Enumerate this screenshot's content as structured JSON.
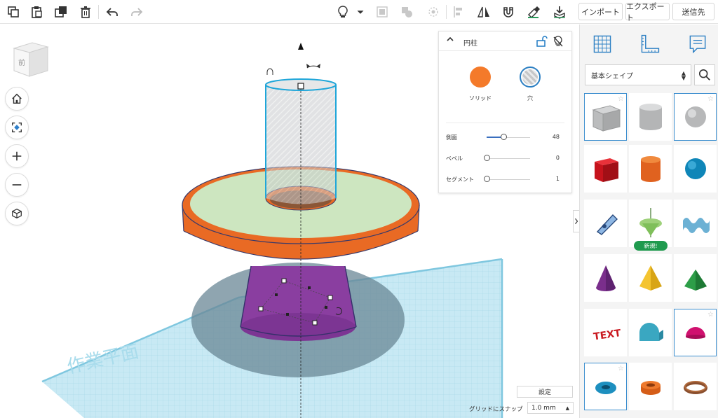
{
  "toolbar": {
    "left_icons": [
      "copy-icon",
      "paste-icon",
      "duplicate-icon",
      "trash-icon",
      "undo-icon",
      "redo-icon"
    ],
    "mid_icons": [
      "lightbulb-icon",
      "dropdown-caret-icon",
      "group-icon",
      "ungroup-icon",
      "workplane-icon",
      "align-icon",
      "mirror-icon",
      "magnet-icon",
      "cruise-icon",
      "drop-icon"
    ],
    "import_label": "インポート",
    "export_label": "エクスポート",
    "send_label": "送信先"
  },
  "viewport": {
    "viewcube_label": "前",
    "workplane_label": "作業平面",
    "nav_icons": [
      "home-icon",
      "fit-view-icon",
      "zoom-in-icon",
      "zoom-out-icon",
      "perspective-icon"
    ],
    "settings_label": "設定",
    "snap_label": "グリッドにスナップ",
    "snap_value": "1.0 mm"
  },
  "inspector": {
    "title": "円柱",
    "solid_label": "ソリッド",
    "hole_label": "穴",
    "solid_color": "#f47a2a",
    "params": [
      {
        "name": "側面",
        "value": "48",
        "level": 0.35
      },
      {
        "name": "ベベル",
        "value": "0",
        "level": 0
      },
      {
        "name": "セグメント",
        "value": "1",
        "level": 0
      }
    ]
  },
  "library": {
    "category": "基本シェイプ",
    "new_badge": "新規!",
    "shapes": [
      "box-hole",
      "cylinder-hole",
      "sphere-hole",
      "box",
      "cylinder",
      "sphere",
      "scribble",
      "shape-generator",
      "text-3d-wave",
      "cone",
      "pyramid",
      "roof",
      "text",
      "half-cylinder",
      "half-sphere",
      "torus",
      "tube",
      "ring"
    ]
  }
}
